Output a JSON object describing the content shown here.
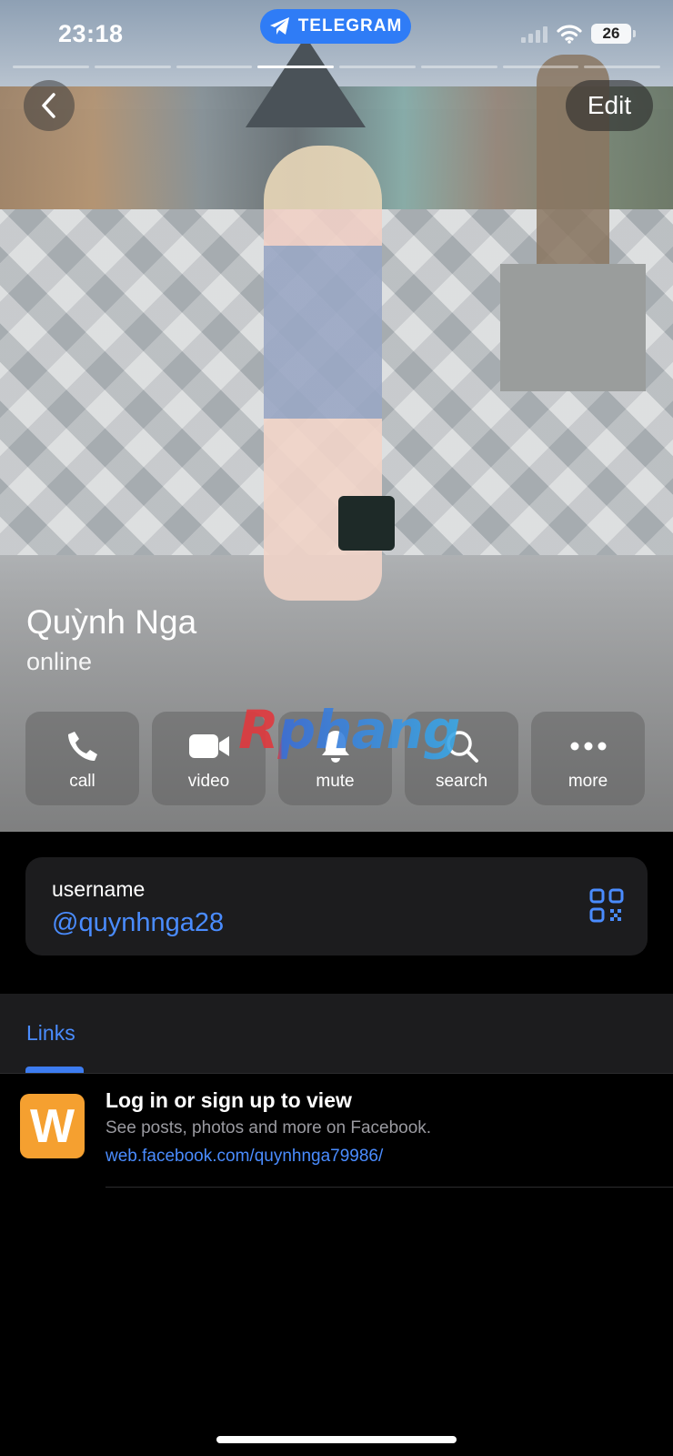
{
  "status_bar": {
    "time": "23:18",
    "app_pill": "TELEGRAM",
    "battery": "26"
  },
  "header": {
    "edit_label": "Edit",
    "story_count": 8,
    "story_active_index": 3
  },
  "profile": {
    "name": "Quỳnh Nga",
    "status": "online"
  },
  "actions": [
    {
      "label": "call",
      "icon": "phone-icon"
    },
    {
      "label": "video",
      "icon": "video-camera-icon"
    },
    {
      "label": "mute",
      "icon": "bell-icon"
    },
    {
      "label": "search",
      "icon": "search-icon"
    },
    {
      "label": "more",
      "icon": "more-dots-icon"
    }
  ],
  "watermark": "Rphang",
  "username": {
    "label": "username",
    "value": "@quynhnga28"
  },
  "links": {
    "tab_label": "Links",
    "items": [
      {
        "thumb_letter": "W",
        "title": "Log in or sign up to view",
        "description": "See posts, photos and more on Facebook.",
        "url": "web.facebook.com/quynhnga79986/"
      }
    ]
  },
  "colors": {
    "accent": "#4a8cff",
    "telegram_pill": "#2f7cf6",
    "thumb": "#f5a030",
    "card_bg": "#1c1c1e"
  }
}
